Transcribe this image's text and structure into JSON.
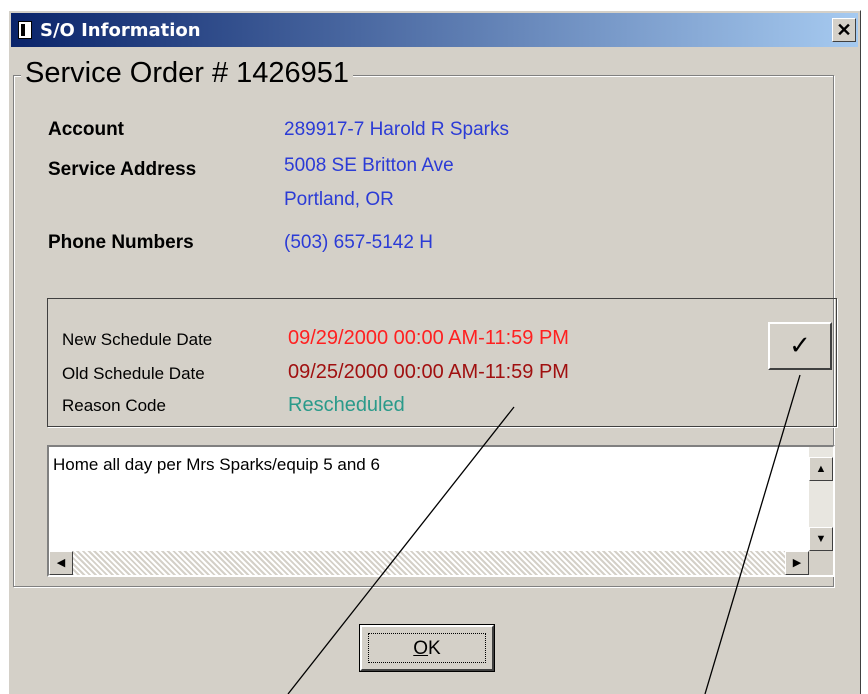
{
  "window": {
    "title": "S/O Information",
    "close_label": "✕"
  },
  "order": {
    "heading": "Service Order # 1426951"
  },
  "fields": {
    "account_label": "Account",
    "account_value": "289917-7  Harold R Sparks",
    "address_label": "Service Address",
    "address_line1": "5008 SE Britton Ave",
    "address_line2": "Portland, OR",
    "phone_label": "Phone Numbers",
    "phone_value": "(503) 657-5142  H"
  },
  "schedule": {
    "new_label": "New Schedule Date",
    "new_value": "09/29/2000 00:00 AM-11:59 PM",
    "old_label": "Old Schedule Date",
    "old_value": "09/25/2000 00:00 AM-11:59 PM",
    "reason_label": "Reason Code",
    "reason_value": "Rescheduled",
    "check_button": "✓"
  },
  "memo": {
    "text": "Home all day per Mrs Sparks/equip 5 and 6"
  },
  "buttons": {
    "ok_prefix": "O",
    "ok_rest": "K"
  },
  "colors": {
    "blue_value": "#2b3bd6",
    "new_date": "#ff2020",
    "old_date": "#a01010",
    "reason": "#2a9a8a"
  },
  "icons": [
    "window-icon",
    "close-icon",
    "checkmark-icon",
    "scroll-up-icon",
    "scroll-down-icon",
    "scroll-left-icon",
    "scroll-right-icon"
  ]
}
